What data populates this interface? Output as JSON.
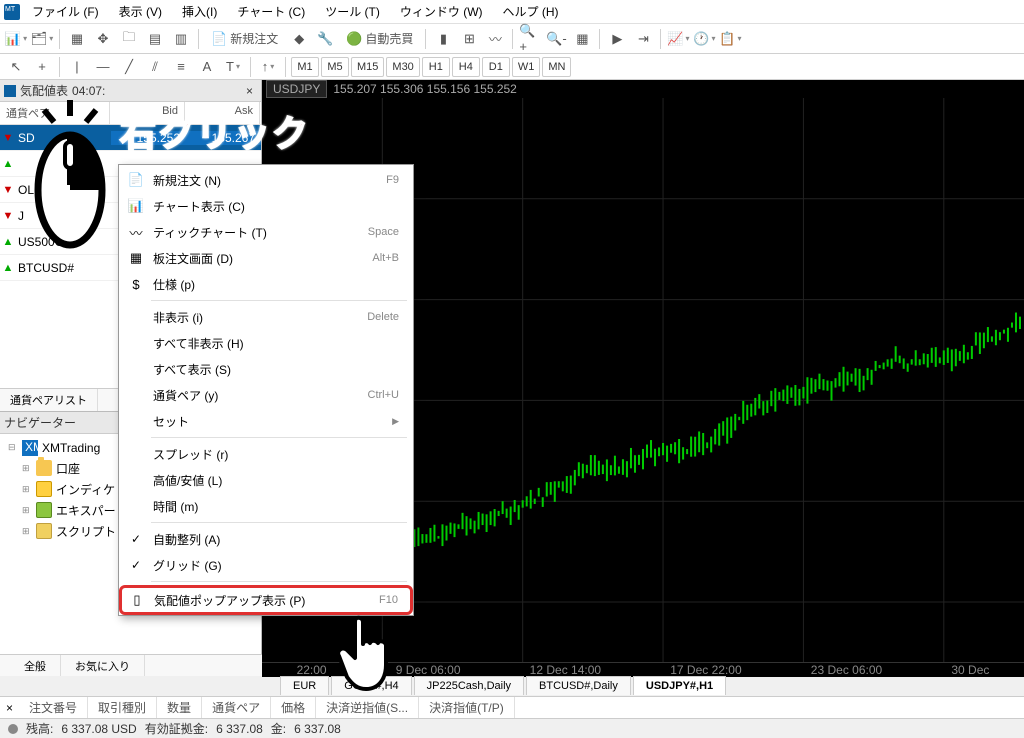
{
  "menu": {
    "items": [
      "ファイル (F)",
      "表示 (V)",
      "挿入(I)",
      "チャート (C)",
      "ツール (T)",
      "ウィンドウ (W)",
      "ヘルプ (H)"
    ]
  },
  "toolbar": {
    "new_order": "新規注文",
    "auto_trade": "自動売買"
  },
  "timeframes": [
    "M1",
    "M5",
    "M15",
    "M30",
    "H1",
    "H4",
    "D1",
    "W1",
    "MN"
  ],
  "market_watch": {
    "title_prefix": "気配値表",
    "time": "04:07:",
    "cols": [
      "通貨ペア",
      "Bid",
      "Ask"
    ],
    "rows": [
      {
        "dir": "dn",
        "sym": "SD",
        "bid": "155.252",
        "ask": "155.267",
        "sel": true
      },
      {
        "dir": "up",
        "sym": "",
        "bid": "",
        "ask": ""
      },
      {
        "dir": "dn",
        "sym": "OLD#",
        "bid": "",
        "ask": ""
      },
      {
        "dir": "dn",
        "sym": "J",
        "bid": "",
        "ask": ""
      },
      {
        "dir": "up",
        "sym": "US500C...",
        "bid": "",
        "ask": ""
      },
      {
        "dir": "up",
        "sym": "BTCUSD#",
        "bid": "",
        "ask": ""
      }
    ],
    "tabs": [
      "通貨ペアリスト"
    ]
  },
  "navigator": {
    "title": "ナビゲーター",
    "root": "XMTrading",
    "items": [
      {
        "icon": "fold",
        "label": "口座"
      },
      {
        "icon": "ind",
        "label": "インディケ"
      },
      {
        "icon": "exp2",
        "label": "エキスパー"
      },
      {
        "icon": "scr",
        "label": "スクリプト"
      }
    ]
  },
  "lower_tabs": [
    "全般",
    "お気に入り"
  ],
  "chart": {
    "symbol_tab": "USDJPY",
    "prices": "155.207 155.306 155.156 155.252",
    "xaxis": [
      "22:00",
      "9 Dec 06:00",
      "12 Dec 14:00",
      "17 Dec 22:00",
      "23 Dec 06:00",
      "30 Dec"
    ]
  },
  "chart_tabs": [
    {
      "label": "EUR",
      "active": false
    },
    {
      "label": "GOLD#,H4",
      "active": false
    },
    {
      "label": "JP225Cash,Daily",
      "active": false
    },
    {
      "label": "BTCUSD#,Daily",
      "active": false
    },
    {
      "label": "USDJPY#,H1",
      "active": true
    }
  ],
  "terminal": {
    "cols": [
      "注文番号",
      "取引種別",
      "数量",
      "通貨ペア",
      "価格",
      "決済逆指値(S...",
      "決済指値(T/P)"
    ]
  },
  "status": {
    "balance_label": "残高:",
    "balance": "6 337.08 USD",
    "equity_label": "有効証拠金:",
    "equity": "6 337.08",
    "extra": "金:",
    "extra_val": "6 337.08"
  },
  "context_menu": [
    {
      "icon": "📄",
      "label": "新規注文 (N)",
      "kb": "F9"
    },
    {
      "icon": "📊",
      "label": "チャート表示 (C)"
    },
    {
      "icon": "〰",
      "label": "ティックチャート (T)",
      "kb": "Space"
    },
    {
      "icon": "▦",
      "label": "板注文画面 (D)",
      "kb": "Alt+B"
    },
    {
      "icon": "$",
      "label": "仕様 (p)"
    },
    {
      "sep": true
    },
    {
      "label": "非表示 (i)",
      "kb": "Delete"
    },
    {
      "label": "すべて非表示 (H)"
    },
    {
      "label": "すべて表示 (S)"
    },
    {
      "label": "通貨ペア (y)",
      "kb": "Ctrl+U"
    },
    {
      "label": "セット",
      "sub": "▶"
    },
    {
      "sep": true
    },
    {
      "label": "スプレッド (r)"
    },
    {
      "label": "高値/安値 (L)"
    },
    {
      "label": "時間 (m)"
    },
    {
      "sep": true
    },
    {
      "chk": "✓",
      "label": "自動整列 (A)"
    },
    {
      "chk": "✓",
      "label": "グリッド (G)"
    },
    {
      "sep": true
    },
    {
      "icon": "▯",
      "label": "気配値ポップアップ表示 (P)",
      "kb": "F10",
      "hl": true
    }
  ],
  "annotation": {
    "text": "右クリック"
  }
}
